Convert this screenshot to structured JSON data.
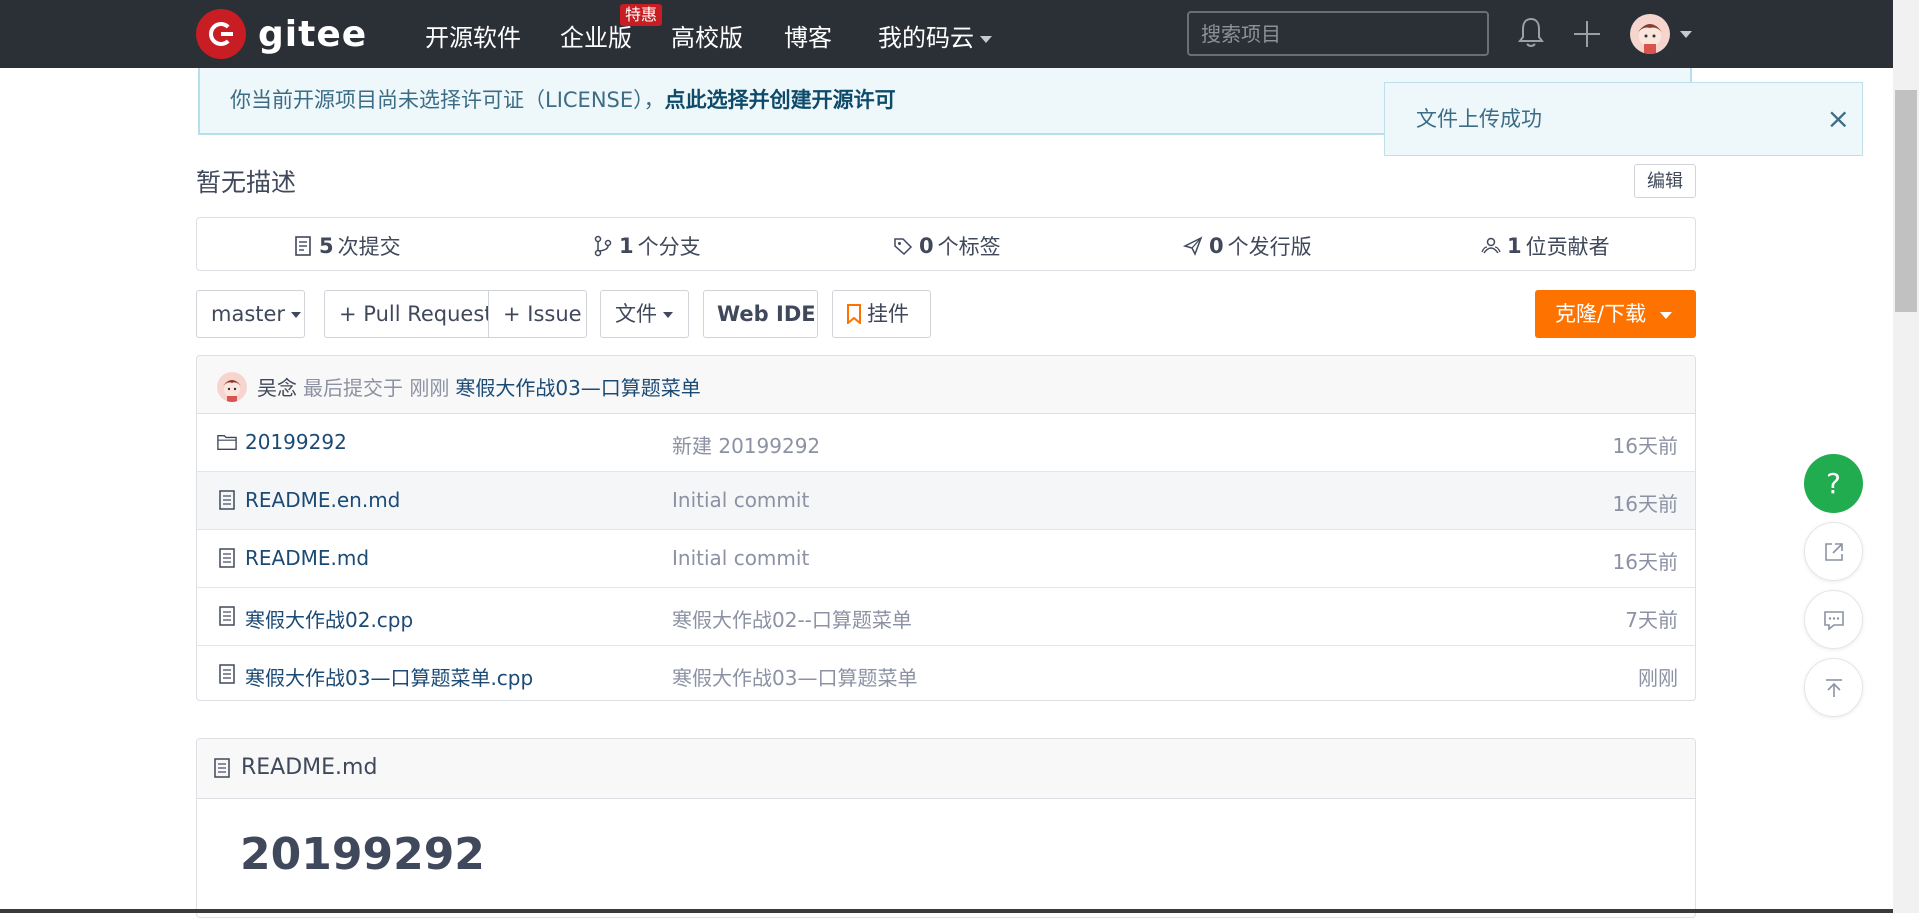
{
  "nav": {
    "logo_text": "gitee",
    "items": [
      "开源软件",
      "企业版",
      "高校版",
      "博客",
      "我的码云"
    ],
    "hot_badge": "特惠",
    "search_placeholder": "搜索项目"
  },
  "license_notice": {
    "text": "你当前开源项目尚未选择许可证（LICENSE），",
    "link": "点此选择并创建开源许可"
  },
  "toast": {
    "message": "文件上传成功",
    "close": "×"
  },
  "repo": {
    "description": "暂无描述",
    "edit_label": "编辑",
    "stats": [
      {
        "count": "5",
        "label": "次提交"
      },
      {
        "count": "1",
        "label": "个分支"
      },
      {
        "count": "0",
        "label": "个标签"
      },
      {
        "count": "0",
        "label": "个发行版"
      },
      {
        "count": "1",
        "label": "位贡献者"
      }
    ]
  },
  "toolbar": {
    "branch": "master",
    "pull_request": "+ Pull Request",
    "issue": "+ Issue",
    "files": "文件",
    "web_ide": "Web IDE",
    "widget": "挂件",
    "clone": "克隆/下载"
  },
  "last_commit": {
    "author": "吴念",
    "meta": "最后提交于 刚刚",
    "message": "寒假大作战03—口算题菜单"
  },
  "files": [
    {
      "name": "20199292",
      "type": "folder",
      "message": "新建 20199292",
      "time": "16天前"
    },
    {
      "name": "README.en.md",
      "type": "file",
      "message": "Initial commit",
      "time": "16天前"
    },
    {
      "name": "README.md",
      "type": "file",
      "message": "Initial commit",
      "time": "16天前"
    },
    {
      "name": "寒假大作战02.cpp",
      "type": "file",
      "message": "寒假大作战02--口算题菜单",
      "time": "7天前"
    },
    {
      "name": "寒假大作战03—口算题菜单.cpp",
      "type": "file",
      "message": "寒假大作战03—口算题菜单",
      "time": "刚刚"
    }
  ],
  "readme": {
    "filename": "README.md",
    "heading": "20199292"
  },
  "fab": {
    "help": "?"
  },
  "colors": {
    "nav_bg": "#2b2f36",
    "brand_red": "#c71d23",
    "clone_orange": "#fe7300",
    "help_green": "#21ad4f",
    "link_blue": "#1b4a75"
  }
}
